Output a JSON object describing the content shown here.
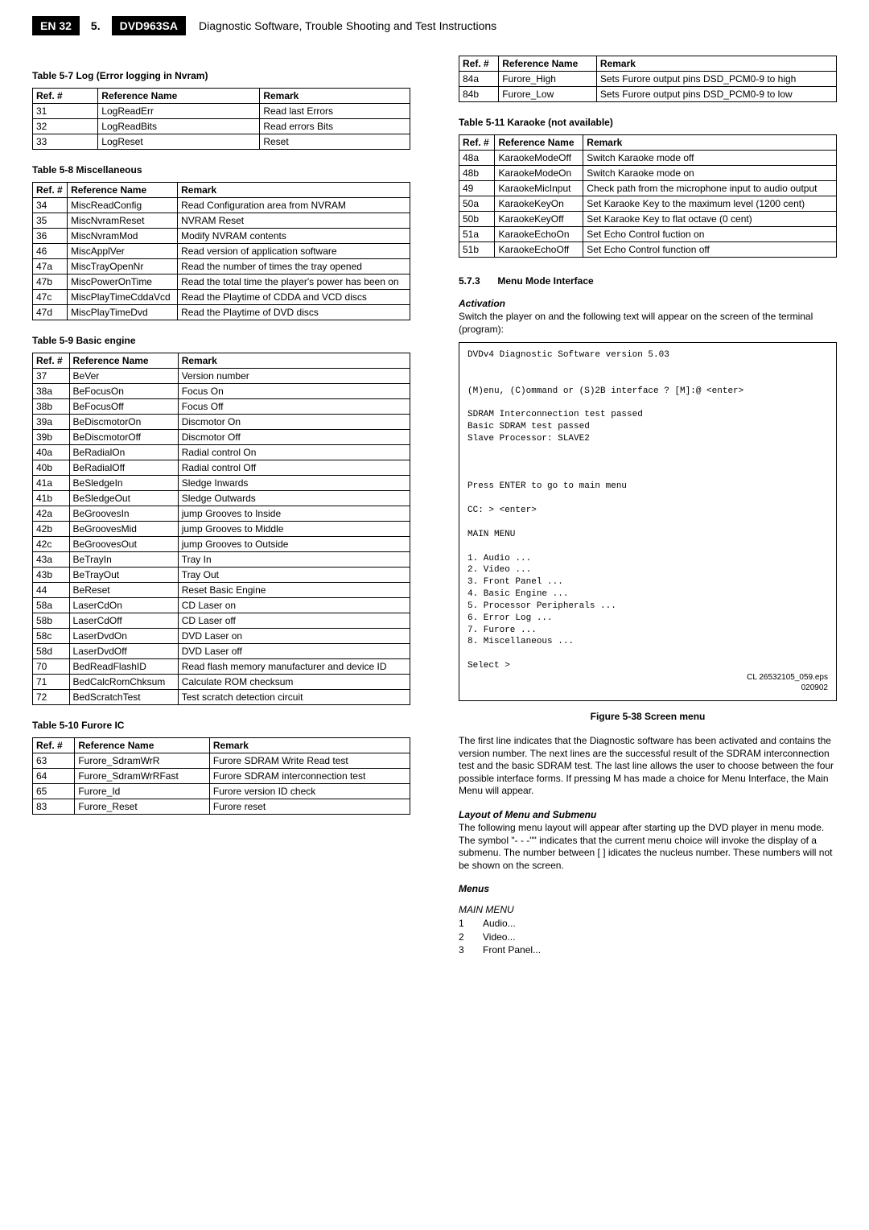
{
  "header": {
    "page_code": "EN 32",
    "section_num": "5.",
    "model": "DVD963SA",
    "title": "Diagnostic Software, Trouble Shooting and Test Instructions"
  },
  "left": {
    "table57_title": "Table 5-7 Log (Error logging in Nvram)",
    "cols": {
      "c1": "Ref. #",
      "c2": "Reference Name",
      "c3": "Remark"
    },
    "table57": [
      {
        "r": "31",
        "n": "LogReadErr",
        "m": "Read last Errors"
      },
      {
        "r": "32",
        "n": "LogReadBits",
        "m": "Read errors Bits"
      },
      {
        "r": "33",
        "n": "LogReset",
        "m": "Reset"
      }
    ],
    "table58_title": "Table 5-8 Miscellaneous",
    "table58": [
      {
        "r": "34",
        "n": "MiscReadConfig",
        "m": "Read Configuration area from NVRAM"
      },
      {
        "r": "35",
        "n": "MiscNvramReset",
        "m": "NVRAM Reset"
      },
      {
        "r": "36",
        "n": "MiscNvramMod",
        "m": "Modify NVRAM contents"
      },
      {
        "r": "46",
        "n": "MiscApplVer",
        "m": "Read version of application software"
      },
      {
        "r": "47a",
        "n": "MiscTrayOpenNr",
        "m": "Read the number of times the tray opened"
      },
      {
        "r": "47b",
        "n": "MiscPowerOnTime",
        "m": "Read the total time the player's power has been on"
      },
      {
        "r": "47c",
        "n": "MiscPlayTimeCddaVcd",
        "m": "Read the Playtime of CDDA and VCD discs"
      },
      {
        "r": "47d",
        "n": "MiscPlayTimeDvd",
        "m": "Read the Playtime of DVD discs"
      }
    ],
    "table59_title": "Table 5-9 Basic engine",
    "table59": [
      {
        "r": "37",
        "n": "BeVer",
        "m": "Version number"
      },
      {
        "r": "38a",
        "n": "BeFocusOn",
        "m": "Focus On"
      },
      {
        "r": "38b",
        "n": "BeFocusOff",
        "m": "Focus Off"
      },
      {
        "r": "39a",
        "n": "BeDiscmotorOn",
        "m": "Discmotor On"
      },
      {
        "r": "39b",
        "n": "BeDiscmotorOff",
        "m": "Discmotor Off"
      },
      {
        "r": "40a",
        "n": "BeRadialOn",
        "m": "Radial control On"
      },
      {
        "r": "40b",
        "n": "BeRadialOff",
        "m": "Radial control Off"
      },
      {
        "r": "41a",
        "n": "BeSledgeIn",
        "m": "Sledge Inwards"
      },
      {
        "r": "41b",
        "n": "BeSledgeOut",
        "m": "Sledge Outwards"
      },
      {
        "r": "42a",
        "n": "BeGroovesIn",
        "m": "jump Grooves to Inside"
      },
      {
        "r": "42b",
        "n": "BeGroovesMid",
        "m": "jump Grooves to Middle"
      },
      {
        "r": "42c",
        "n": "BeGroovesOut",
        "m": "jump Grooves to Outside"
      },
      {
        "r": "43a",
        "n": "BeTrayIn",
        "m": "Tray In"
      },
      {
        "r": "43b",
        "n": "BeTrayOut",
        "m": "Tray Out"
      },
      {
        "r": "44",
        "n": "BeReset",
        "m": "Reset Basic Engine"
      },
      {
        "r": "58a",
        "n": "LaserCdOn",
        "m": "CD Laser on"
      },
      {
        "r": "58b",
        "n": "LaserCdOff",
        "m": "CD Laser off"
      },
      {
        "r": "58c",
        "n": "LaserDvdOn",
        "m": "DVD Laser on"
      },
      {
        "r": "58d",
        "n": "LaserDvdOff",
        "m": "DVD Laser off"
      },
      {
        "r": "70",
        "n": "BedReadFlashID",
        "m": "Read flash memory manufacturer and device ID"
      },
      {
        "r": "71",
        "n": "BedCalcRomChksum",
        "m": "Calculate ROM checksum"
      },
      {
        "r": "72",
        "n": "BedScratchTest",
        "m": "Test scratch detection circuit"
      }
    ],
    "table510_title": "Table 5-10 Furore IC",
    "table510": [
      {
        "r": "63",
        "n": "Furore_SdramWrR",
        "m": "Furore SDRAM Write Read test"
      },
      {
        "r": "64",
        "n": "Furore_SdramWrRFast",
        "m": "Furore SDRAM interconnection test"
      },
      {
        "r": "65",
        "n": "Furore_Id",
        "m": "Furore version ID check"
      },
      {
        "r": "83",
        "n": "Furore_Reset",
        "m": "Furore reset"
      }
    ]
  },
  "right": {
    "table510b": [
      {
        "r": "84a",
        "n": "Furore_High",
        "m": "Sets Furore output pins DSD_PCM0-9 to high"
      },
      {
        "r": "84b",
        "n": "Furore_Low",
        "m": "Sets Furore output pins DSD_PCM0-9 to low"
      }
    ],
    "table511_title": "Table 5-11 Karaoke (not available)",
    "table511": [
      {
        "r": "48a",
        "n": "KaraokeModeOff",
        "m": "Switch Karaoke mode off"
      },
      {
        "r": "48b",
        "n": "KaraokeModeOn",
        "m": "Switch Karaoke mode on"
      },
      {
        "r": "49",
        "n": "KaraokeMicInput",
        "m": "Check path from the microphone input to audio output"
      },
      {
        "r": "50a",
        "n": "KaraokeKeyOn",
        "m": "Set Karaoke Key to the maximum level (1200 cent)"
      },
      {
        "r": "50b",
        "n": "KaraokeKeyOff",
        "m": "Set Karaoke Key to flat octave (0 cent)"
      },
      {
        "r": "51a",
        "n": "KaraokeEchoOn",
        "m": "Set Echo Control fuction on"
      },
      {
        "r": "51b",
        "n": "KaraokeEchoOff",
        "m": "Set Echo Control function off"
      }
    ],
    "sec573_num": "5.7.3",
    "sec573_title": "Menu Mode Interface",
    "activation_h": "Activation",
    "activation_p": "Switch the player on and the following text will appear on the screen of the terminal (program):",
    "terminal": "DVDv4 Diagnostic Software version 5.03\n\n\n(M)enu, (C)ommand or (S)2B interface ? [M]:@ <enter>\n\nSDRAM Interconnection test passed\nBasic SDRAM test passed\nSlave Processor: SLAVE2\n\n\n\nPress ENTER to go to main menu\n\nCC: > <enter>\n\nMAIN MENU\n\n1. Audio ...\n2. Video ...\n3. Front Panel ...\n4. Basic Engine ...\n5. Processor Peripherals ...\n6. Error Log ...\n7. Furore ...\n8. Miscellaneous ...\n\nSelect >",
    "terminal_eps": "CL 26532105_059.eps\n020902",
    "fig_caption": "Figure 5-38 Screen menu",
    "para1": "The first line indicates that the Diagnostic software has been activated and contains the version number. The next lines are the successful result of the SDRAM interconnection test and the basic SDRAM test. The last line allows the user to choose between the four possible interface forms. If pressing M has made a choice for Menu Interface, the Main Menu will appear.",
    "layout_h": "Layout of Menu and Submenu",
    "para2": "The following menu layout will appear after starting up the DVD player in menu mode. The symbol \"- - -\"\" indicates that the current menu choice will invoke the display of a submenu. The number between [ ] idicates the nucleus number. These numbers will not be shown on the screen.",
    "menus_h": "Menus",
    "mainmenu_h": "MAIN MENU",
    "mainmenu": [
      {
        "n": "1",
        "t": "Audio..."
      },
      {
        "n": "2",
        "t": "Video..."
      },
      {
        "n": "3",
        "t": "Front Panel..."
      }
    ]
  }
}
